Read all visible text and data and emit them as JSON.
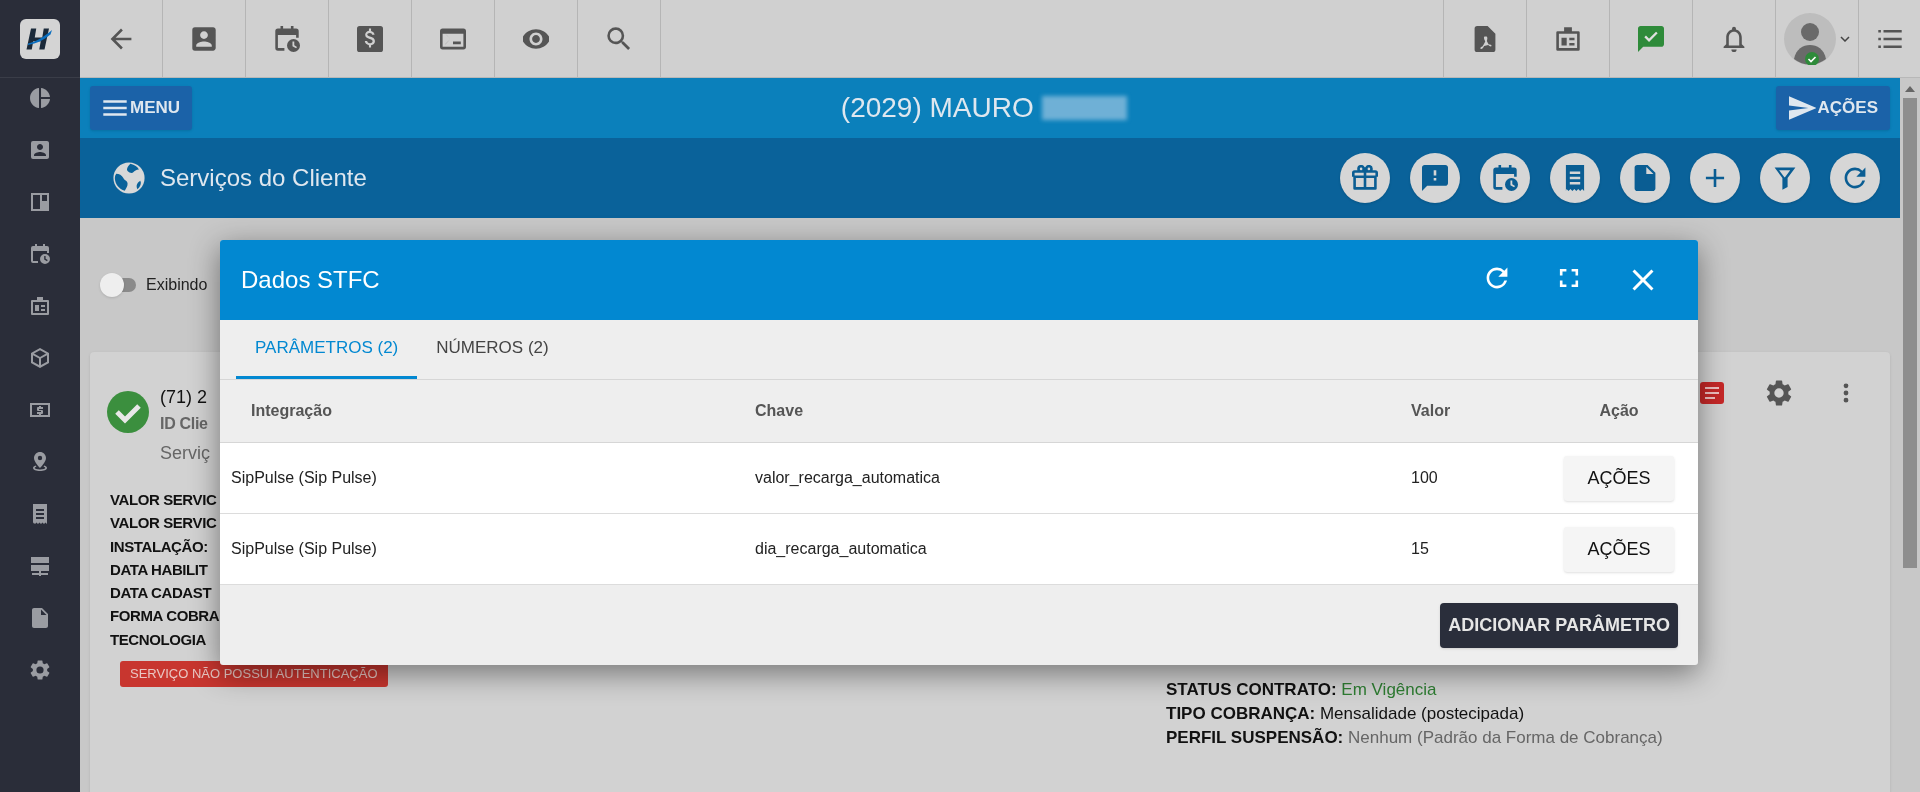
{
  "header": {
    "menu_button": "MENU",
    "title": "(2029) MAURO",
    "actions_button": "AÇÕES"
  },
  "section": {
    "title": "Serviços do Cliente"
  },
  "toggle": {
    "label": "Exibindo",
    "on": false
  },
  "service_card": {
    "phone": "(71) 2",
    "id_line": "ID Clie",
    "service_line": "Serviç",
    "details_left": [
      "VALOR SERVIC",
      "VALOR SERVIC",
      "INSTALAÇÃO:",
      "DATA HABILIT",
      "DATA CADAST",
      "FORMA COBRA",
      "TECNOLOGIA"
    ],
    "badge": "SERVIÇO NÃO POSSUI AUTENTICAÇÃO",
    "details_right": [
      {
        "label": "STATUS CONTRATO:",
        "value": "Em Vigência",
        "kind": "status"
      },
      {
        "label": "TIPO COBRANÇA:",
        "value": "Mensalidade (postecipada)",
        "kind": "plain"
      },
      {
        "label": "PERFIL SUSPENSÃO:",
        "value": "Nenhum (Padrão da Forma de Cobrança)",
        "kind": "muted"
      }
    ]
  },
  "modal": {
    "title": "Dados STFC",
    "tabs": [
      {
        "label": "PARÂMETROS (2)",
        "selected": true
      },
      {
        "label": "NÚMEROS (2)",
        "selected": false
      }
    ],
    "table": {
      "columns": [
        "Integração",
        "Chave",
        "Valor",
        "Ação"
      ],
      "rows": [
        {
          "integration": "SipPulse (Sip Pulse)",
          "key": "valor_recarga_automatica",
          "value": "100",
          "action": "AÇÕES"
        },
        {
          "integration": "SipPulse (Sip Pulse)",
          "key": "dia_recarga_automatica",
          "value": "15",
          "action": "AÇÕES"
        }
      ]
    },
    "footer_button": "ADICIONAR PARÂMETRO"
  }
}
